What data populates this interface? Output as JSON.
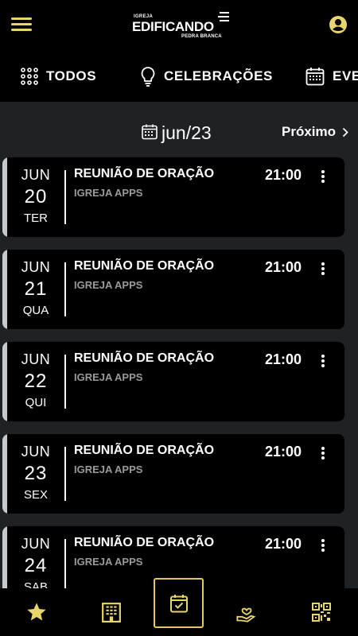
{
  "header": {
    "logo_top": "IGREJA",
    "logo_main": "EDIFICANDO",
    "logo_sub": "PEDRA BRANCA"
  },
  "tabs": [
    {
      "label": "TODOS",
      "icon": "grid-dots-icon",
      "active": true
    },
    {
      "label": "CELEBRAÇÕES",
      "icon": "lightbulb-icon",
      "active": false
    },
    {
      "label": "EVE",
      "icon": "calendar-grid-icon",
      "active": false
    }
  ],
  "month_nav": {
    "current": "jun/23",
    "next_label": "Próximo"
  },
  "events": [
    {
      "month": "JUN",
      "day": "20",
      "weekday": "TER",
      "title": "REUNIÃO DE ORAÇÃO",
      "org": "IGREJA APPS",
      "time": "21:00"
    },
    {
      "month": "JUN",
      "day": "21",
      "weekday": "QUA",
      "title": "REUNIÃO DE ORAÇÃO",
      "org": "IGREJA APPS",
      "time": "21:00"
    },
    {
      "month": "JUN",
      "day": "22",
      "weekday": "QUI",
      "title": "REUNIÃO DE ORAÇÃO",
      "org": "IGREJA APPS",
      "time": "21:00"
    },
    {
      "month": "JUN",
      "day": "23",
      "weekday": "SEX",
      "title": "REUNIÃO DE ORAÇÃO",
      "org": "IGREJA APPS",
      "time": "21:00"
    },
    {
      "month": "JUN",
      "day": "24",
      "weekday": "SAB",
      "title": "REUNIÃO DE ORAÇÃO",
      "org": "IGREJA APPS",
      "time": "21:00"
    }
  ],
  "bottom_nav": [
    {
      "icon": "star-icon",
      "active": false
    },
    {
      "icon": "building-icon",
      "active": false
    },
    {
      "icon": "calendar-check-icon",
      "active": true
    },
    {
      "icon": "hand-heart-icon",
      "active": false
    },
    {
      "icon": "qr-code-icon",
      "active": false
    }
  ],
  "colors": {
    "accent": "#e8d56b",
    "background": "#1f2225",
    "card": "#000000",
    "muted_text": "#9a9a9a"
  }
}
